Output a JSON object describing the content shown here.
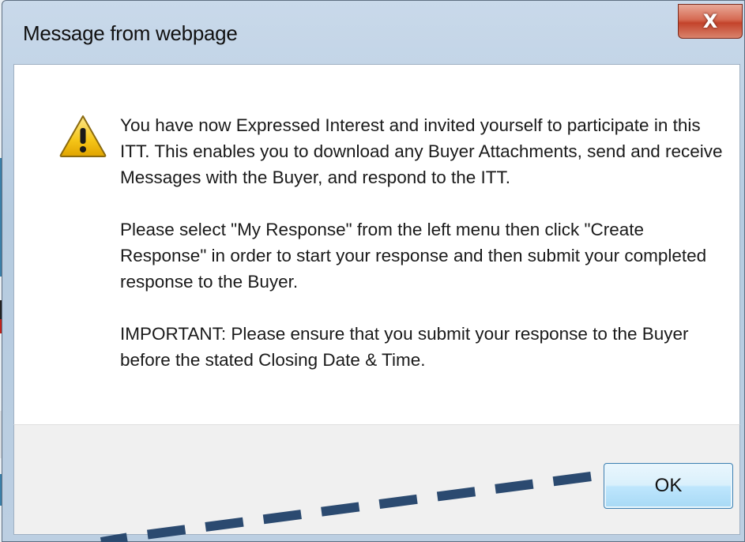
{
  "dialog": {
    "title": "Message from webpage",
    "close_label": "X",
    "icon": "warning-icon",
    "paragraphs": [
      "You have now Expressed Interest and invited yourself to participate in this ITT. This enables you to download any Buyer Attachments, send and receive Messages with the Buyer, and respond to the ITT.",
      "Please select \"My Response\" from the left menu then click \"Create Response\" in order to start your response and then submit your completed response to the Buyer.",
      "IMPORTANT: Please ensure that you submit your response to the Buyer before the stated Closing Date & Time."
    ],
    "ok_label": "OK"
  },
  "colors": {
    "annotation_dash": "#2b4a70",
    "close_button": "#c3432b",
    "ok_button_border": "#3c7fb1",
    "warning_fill": "#f5c518"
  }
}
